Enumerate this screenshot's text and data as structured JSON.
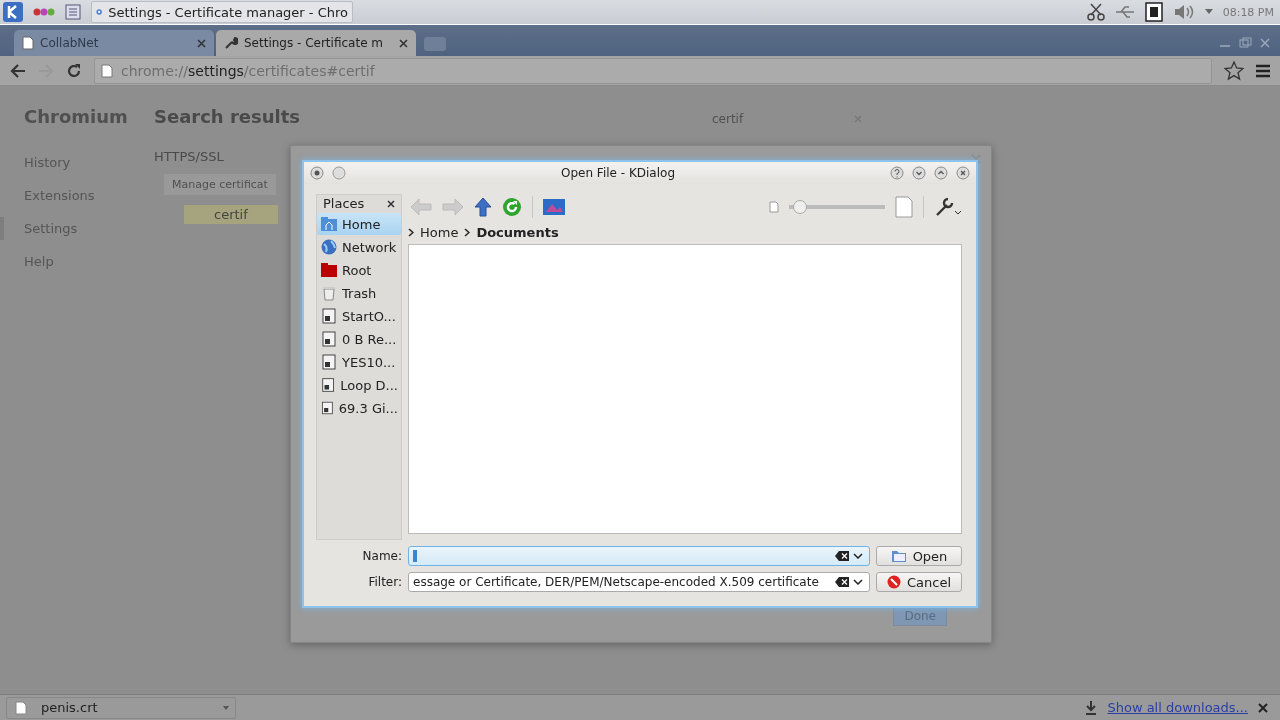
{
  "taskbar": {
    "window_button": "Settings - Certificate manager - Chro",
    "clock": "08:18 PM"
  },
  "browser": {
    "tabs": [
      {
        "label": "CollabNet",
        "selected": false
      },
      {
        "label": "Settings - Certificate m",
        "selected": true
      }
    ],
    "url": {
      "scheme": "chrome://",
      "host": "settings",
      "path": "/certificates#certif"
    }
  },
  "settings_page": {
    "brand": "Chromium",
    "nav": [
      {
        "label": "History",
        "selected": false
      },
      {
        "label": "Extensions",
        "selected": false
      },
      {
        "label": "Settings",
        "selected": true
      },
      {
        "label": "Help",
        "selected": false
      }
    ],
    "heading": "Search results",
    "section": "HTTPS/SSL",
    "manage_button": "Manage certificat",
    "match": "certif",
    "search": {
      "value": "certif"
    }
  },
  "certificate_manager": {
    "done_button": "Done"
  },
  "dialog": {
    "title": "Open File - KDialog",
    "places": {
      "title": "Places",
      "items": [
        {
          "label": "Home",
          "kind": "home",
          "selected": true
        },
        {
          "label": "Network",
          "kind": "network",
          "selected": false
        },
        {
          "label": "Root",
          "kind": "root",
          "selected": false
        },
        {
          "label": "Trash",
          "kind": "trash",
          "selected": false
        },
        {
          "label": "StartO...",
          "kind": "drive",
          "selected": false
        },
        {
          "label": "0 B Re...",
          "kind": "drive",
          "selected": false
        },
        {
          "label": "YES10...",
          "kind": "drive",
          "selected": false
        },
        {
          "label": "Loop D...",
          "kind": "drive",
          "selected": false
        },
        {
          "label": "69.3 Gi...",
          "kind": "drive",
          "selected": false
        }
      ]
    },
    "breadcrumb": [
      {
        "label": "Home",
        "current": false
      },
      {
        "label": "Documents",
        "current": true
      }
    ],
    "zoom": {
      "level": 0.05
    },
    "name": {
      "label": "Name:"
    },
    "filter": {
      "label": "Filter:",
      "value": "essage or Certificate, DER/PEM/Netscape-encoded X.509 certificate"
    },
    "buttons": [
      {
        "label": "Open",
        "kind": "open"
      },
      {
        "label": "Cancel",
        "kind": "cancel"
      }
    ]
  },
  "download_bar": {
    "file": "penis.crt",
    "link": "Show all downloads..."
  }
}
